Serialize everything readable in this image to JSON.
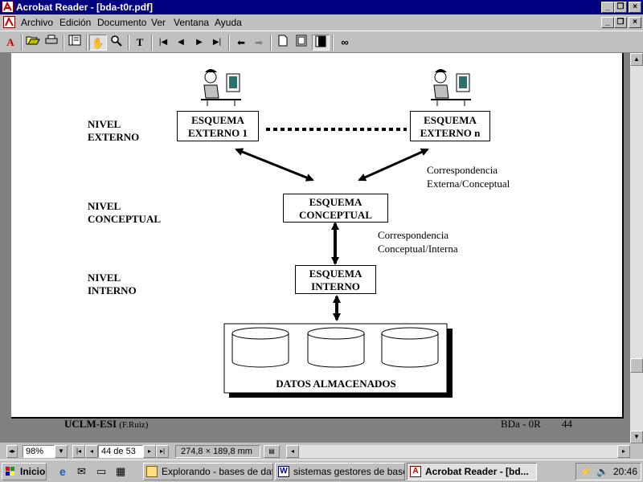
{
  "window": {
    "title": "Acrobat Reader - [bda-t0r.pdf]"
  },
  "menu": [
    "Archivo",
    "Edición",
    "Documento",
    "Ver",
    "Ventana",
    "Ayuda"
  ],
  "toolbar_icons": [
    "open-icon",
    "print-icon",
    "thumbnails-icon",
    "hand-tool-icon",
    "zoom-tool-icon",
    "text-select-icon",
    "first-page-icon",
    "prev-page-icon",
    "next-page-icon",
    "last-page-icon",
    "go-back-icon",
    "go-forward-icon",
    "actual-size-icon",
    "fit-page-icon",
    "fit-width-icon",
    "find-icon"
  ],
  "document": {
    "levels": {
      "external": "NIVEL\nEXTERNO",
      "conceptual": "NIVEL\nCONCEPTUAL",
      "internal": "NIVEL\nINTERNO"
    },
    "boxes": {
      "external1": "ESQUEMA\nEXTERNO 1",
      "externaln": "ESQUEMA\nEXTERNO n",
      "conceptual": "ESQUEMA\nCONCEPTUAL",
      "internal": "ESQUEMA\nINTERNO",
      "storage": "DATOS ALMACENADOS"
    },
    "correspondences": {
      "ext_conc": "Correspondencia\nExterna/Conceptual",
      "conc_int": "Correspondencia\nConceptual/Interna"
    },
    "footer": {
      "left_bold": "UCLM-ESI",
      "left_author": "(F.Ruiz)",
      "code": "BDa - 0R",
      "page": "44"
    }
  },
  "status": {
    "zoom": "98%",
    "page": "44 de 53",
    "size": "274,8 × 189,8  mm"
  },
  "taskbar": {
    "start": "Inicio",
    "tasks": [
      "Explorando - bases de datos",
      "sistemas gestores de base...",
      "Acrobat Reader - [bd..."
    ],
    "clock": "20:46"
  },
  "colors": {
    "titlebar": "#000080",
    "face": "#c0c0c0",
    "doc_bg": "#808080"
  }
}
